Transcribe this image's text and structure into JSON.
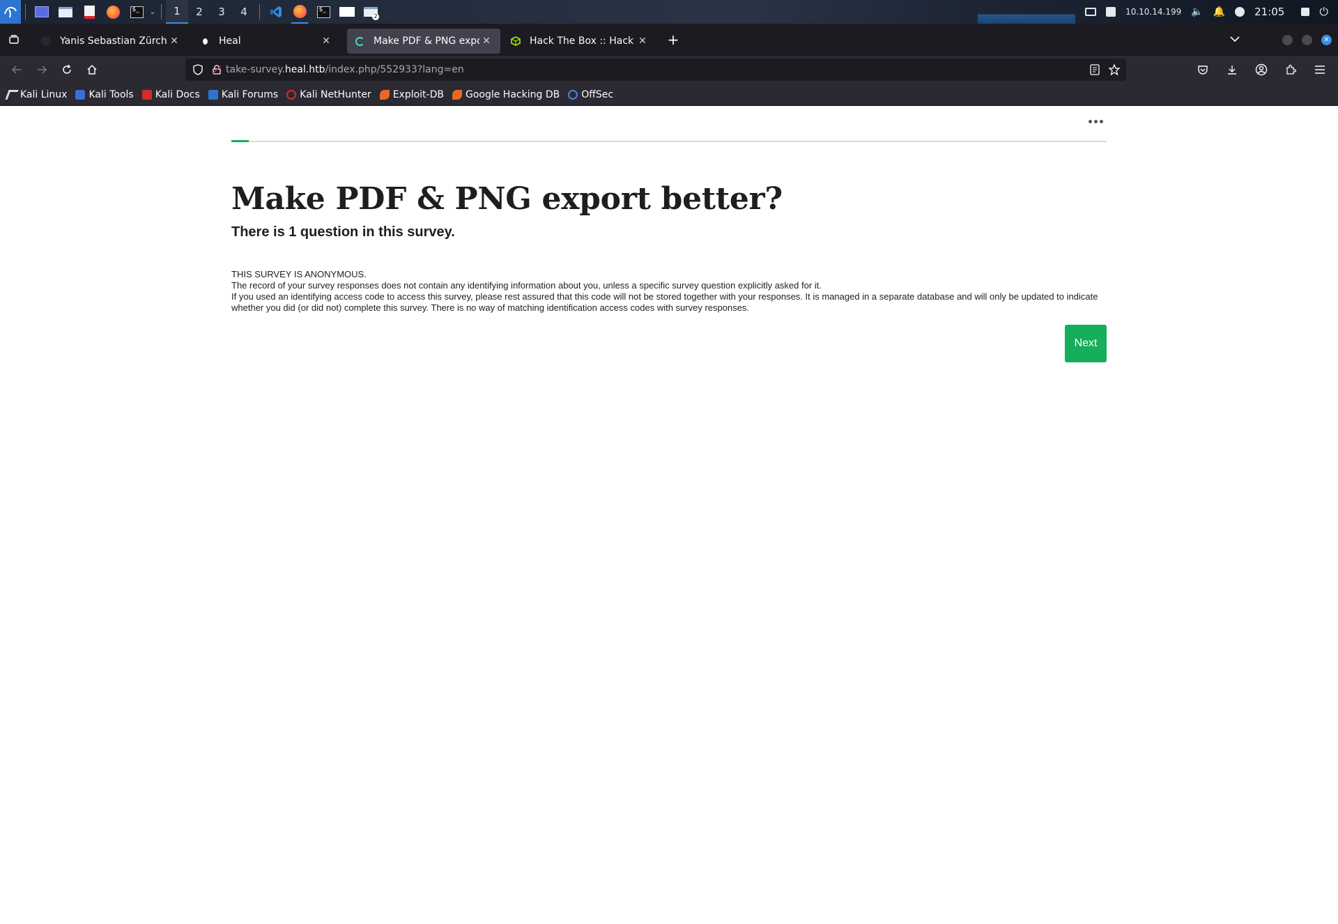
{
  "taskbar": {
    "workspaces": [
      "1",
      "2",
      "3",
      "4"
    ],
    "active_workspace": "1",
    "ip_address": "10.10.14.199",
    "clock": "21:05",
    "icons": [
      "kali-menu-icon",
      "desktop-icon",
      "file-manager-icon",
      "text-editor-icon",
      "firefox-icon",
      "terminal-icon",
      "vscode-icon",
      "firefox-icon",
      "terminal-icon",
      "window-icon",
      "folder-icon"
    ]
  },
  "browser": {
    "tabs": [
      {
        "label": "Yanis Sebastian Zürcher |",
        "active": false
      },
      {
        "label": "Heal",
        "active": false
      },
      {
        "label": "Make PDF & PNG export b",
        "active": true
      },
      {
        "label": "Hack The Box :: Hack The",
        "active": false
      }
    ],
    "new_tab_label": "+",
    "url": {
      "prefix": "take-survey.",
      "host": "heal.htb",
      "path": "/index.php/552933?lang=en"
    },
    "bookmarks": [
      {
        "label": "Kali Linux"
      },
      {
        "label": "Kali Tools"
      },
      {
        "label": "Kali Docs"
      },
      {
        "label": "Kali Forums"
      },
      {
        "label": "Kali NetHunter"
      },
      {
        "label": "Exploit-DB"
      },
      {
        "label": "Google Hacking DB"
      },
      {
        "label": "OffSec"
      }
    ]
  },
  "survey": {
    "progress_percent": 2,
    "title": "Make PDF & PNG export better?",
    "question_count_text": "There is 1 question in this survey.",
    "anonymous_heading": "THIS SURVEY IS ANONYMOUS.",
    "anonymous_line1": "The record of your survey responses does not contain any identifying information about you, unless a specific survey question explicitly asked for it.",
    "anonymous_line2": "If you used an identifying access code to access this survey, please rest assured that this code will not be stored together with your responses. It is managed in a separate database and will only be updated to indicate whether you did (or did not) complete this survey. There is no way of matching identification access codes with survey responses.",
    "next_label": "Next"
  },
  "colors": {
    "accent_green": "#14ae5c",
    "browser_dark": "#1c1b22",
    "toolbar": "#2b2a33"
  }
}
